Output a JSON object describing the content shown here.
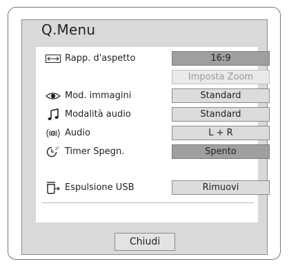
{
  "title": "Q.Menu",
  "rows": [
    {
      "icon": "aspect-ratio-icon",
      "label": "Rapp. d'aspetto",
      "value": "16:9",
      "state": "selected"
    },
    {
      "icon": "",
      "label": "",
      "value": "Imposta Zoom",
      "state": "disabled"
    },
    {
      "icon": "eye-icon",
      "label": "Mod. immagini",
      "value": "Standard",
      "state": "normal"
    },
    {
      "icon": "music-note-icon",
      "label": "Modalità audio",
      "value": "Standard",
      "state": "normal"
    },
    {
      "icon": "audio-icon",
      "label": "Audio",
      "value": "L + R",
      "state": "normal"
    },
    {
      "icon": "sleep-timer-icon",
      "label": "Timer Spegn.",
      "value": "Spento",
      "state": "selected"
    },
    {
      "icon": "usb-eject-icon",
      "label": "Espulsione USB",
      "value": "Rimuovi",
      "state": "normal"
    }
  ],
  "close_label": "Chiudi"
}
